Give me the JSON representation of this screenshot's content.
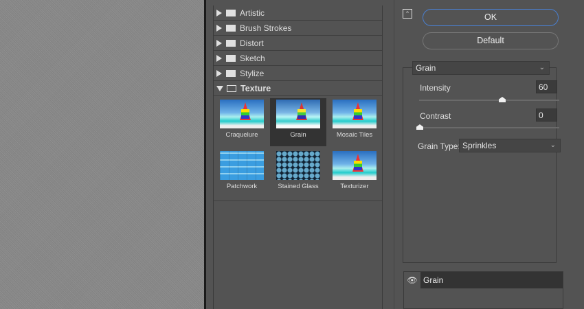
{
  "categories": [
    {
      "label": "Artistic",
      "expanded": false
    },
    {
      "label": "Brush Strokes",
      "expanded": false
    },
    {
      "label": "Distort",
      "expanded": false
    },
    {
      "label": "Sketch",
      "expanded": false
    },
    {
      "label": "Stylize",
      "expanded": false
    },
    {
      "label": "Texture",
      "expanded": true
    }
  ],
  "texture_filters": [
    "Craquelure",
    "Grain",
    "Mosaic Tiles",
    "Patchwork",
    "Stained Glass",
    "Texturizer"
  ],
  "selected_filter": "Grain",
  "buttons": {
    "ok": "OK",
    "default": "Default"
  },
  "settings": {
    "filter_select": "Grain",
    "intensity_label": "Intensity",
    "intensity": "60",
    "intensity_fraction": 0.6,
    "contrast_label": "Contrast",
    "contrast": "0",
    "contrast_fraction": 0,
    "grain_type_label": "Grain Type:",
    "grain_type": "Sprinkles"
  },
  "layers": [
    {
      "name": "Grain",
      "visible": true
    }
  ],
  "colors": {
    "accent": "#4a7fd0",
    "panel": "#535353"
  }
}
